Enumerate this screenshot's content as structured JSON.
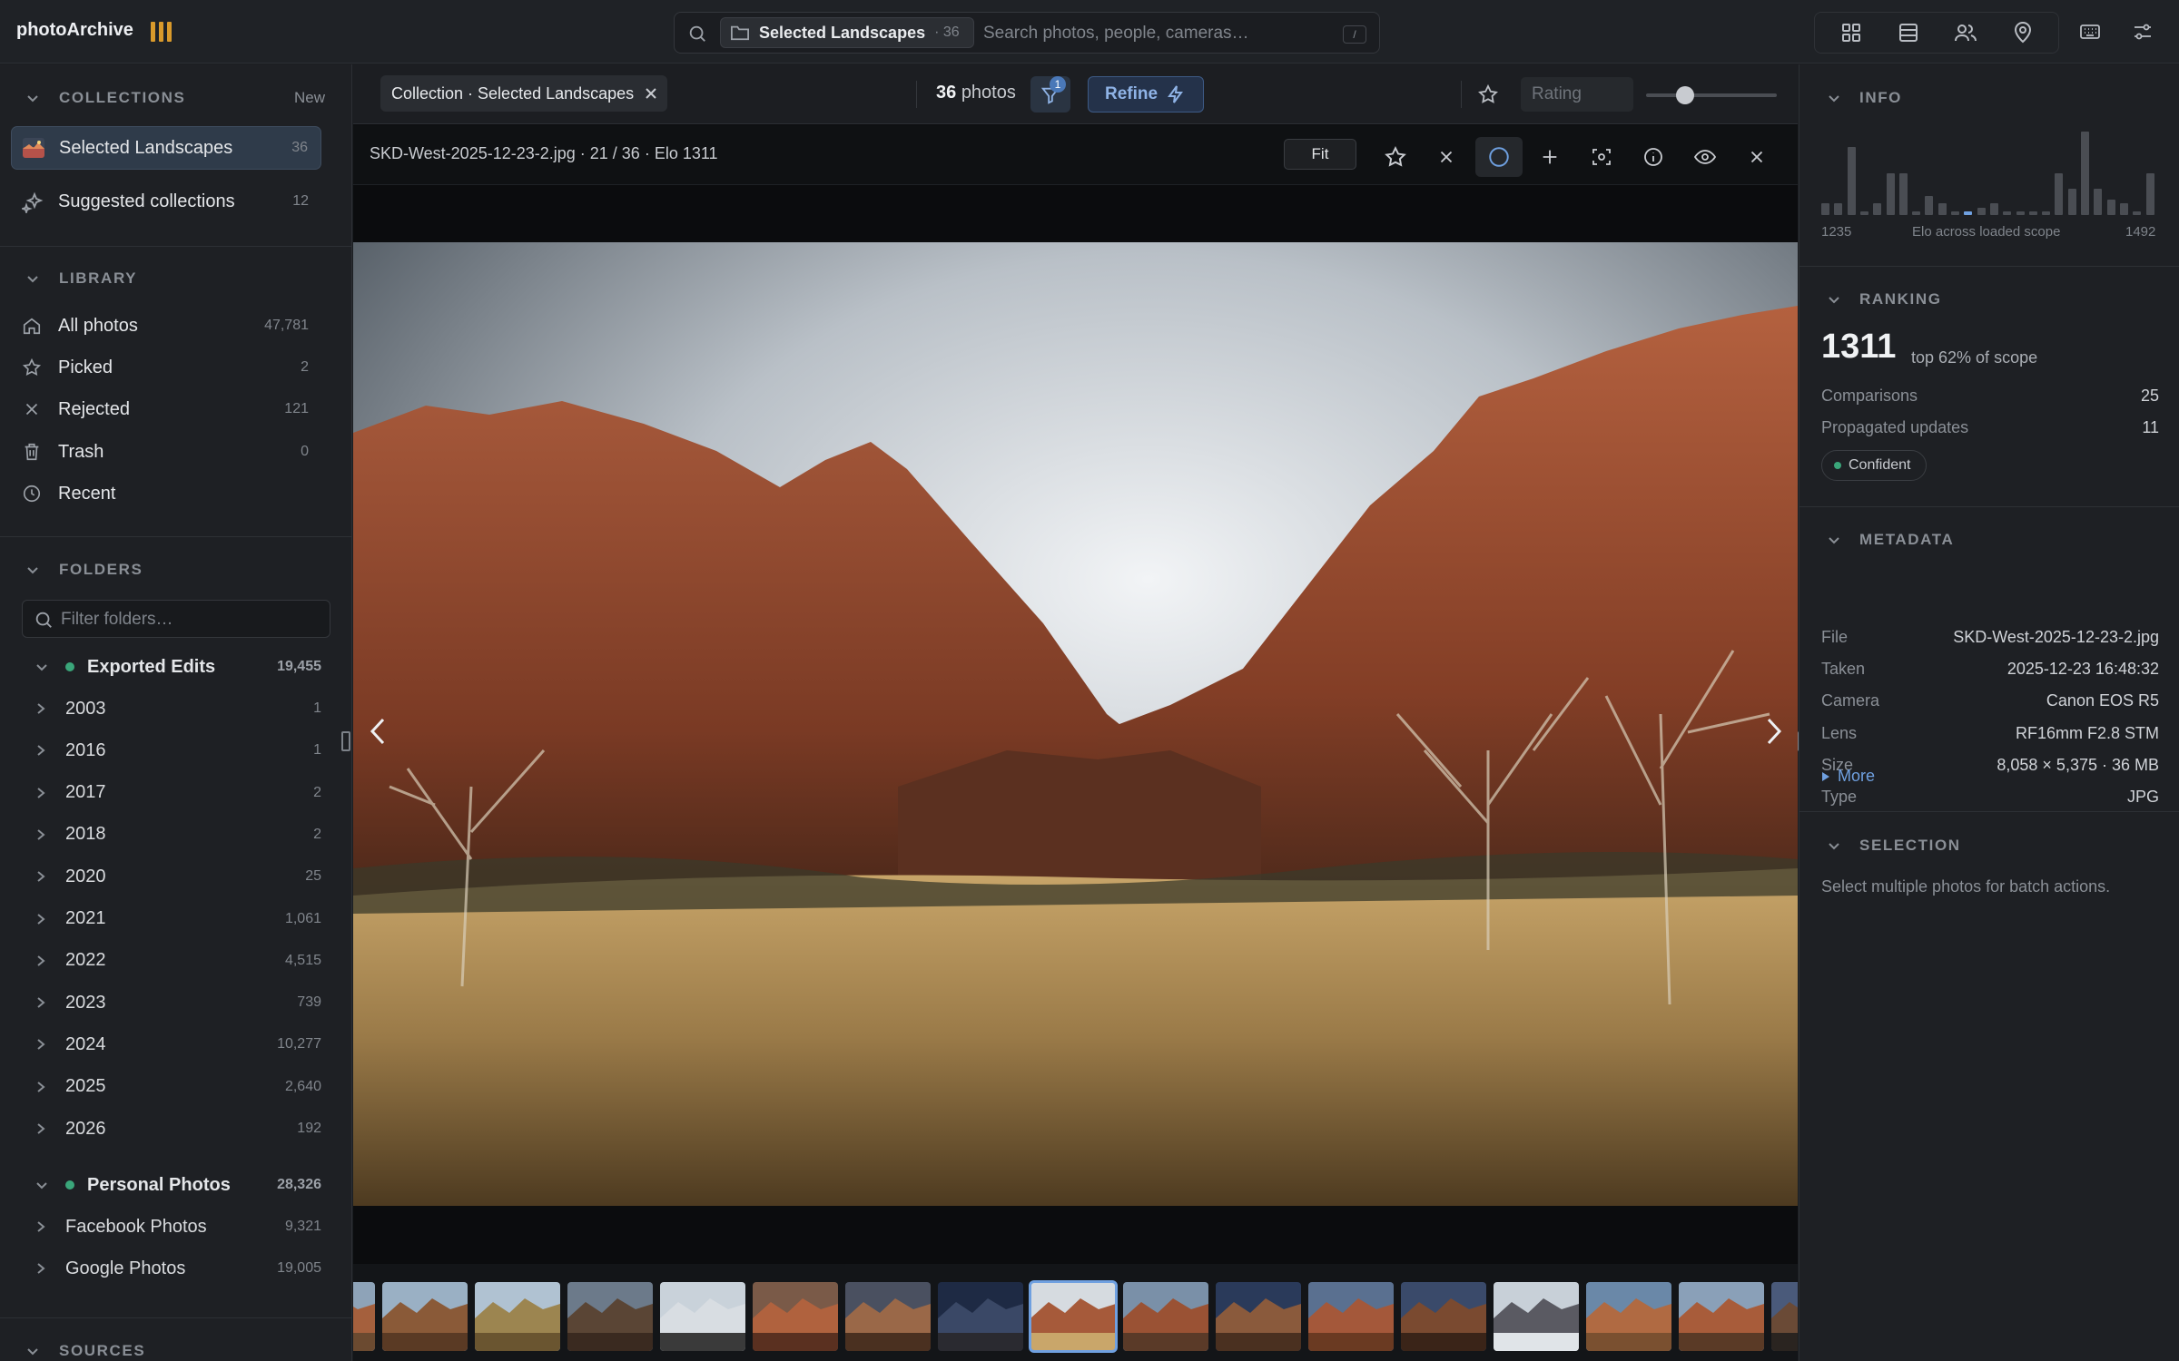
{
  "app": {
    "name": "photoArchive"
  },
  "search": {
    "scope_label": "Selected Landscapes",
    "scope_count": "· 36",
    "placeholder": "Search photos, people, cameras…",
    "shortcut": "/"
  },
  "toolbar_icons": [
    "grid-view-icon",
    "list-view-icon",
    "people-icon",
    "map-pin-icon",
    "keyboard-icon",
    "sliders-icon"
  ],
  "sidebar": {
    "collections": {
      "title": "COLLECTIONS",
      "new_label": "New",
      "items": [
        {
          "label": "Selected Landscapes",
          "count": "36"
        },
        {
          "label": "Suggested collections",
          "count": "12"
        }
      ]
    },
    "library": {
      "title": "LIBRARY",
      "items": [
        {
          "label": "All photos",
          "count": "47,781",
          "icon": "home-icon"
        },
        {
          "label": "Picked",
          "count": "2",
          "icon": "star-icon"
        },
        {
          "label": "Rejected",
          "count": "121",
          "icon": "x-icon"
        },
        {
          "label": "Trash",
          "count": "0",
          "icon": "trash-icon"
        },
        {
          "label": "Recent",
          "count": "",
          "icon": "clock-icon"
        }
      ]
    },
    "folders": {
      "title": "FOLDERS",
      "filter_placeholder": "Filter folders…",
      "groups": [
        {
          "label": "Exported Edits",
          "count": "19,455",
          "children": [
            {
              "label": "2003",
              "count": "1"
            },
            {
              "label": "2016",
              "count": "1"
            },
            {
              "label": "2017",
              "count": "2"
            },
            {
              "label": "2018",
              "count": "2"
            },
            {
              "label": "2020",
              "count": "25"
            },
            {
              "label": "2021",
              "count": "1,061"
            },
            {
              "label": "2022",
              "count": "4,515"
            },
            {
              "label": "2023",
              "count": "739"
            },
            {
              "label": "2024",
              "count": "10,277"
            },
            {
              "label": "2025",
              "count": "2,640"
            },
            {
              "label": "2026",
              "count": "192"
            }
          ]
        },
        {
          "label": "Personal Photos",
          "count": "28,326",
          "children": [
            {
              "label": "Facebook Photos",
              "count": "9,321"
            },
            {
              "label": "Google Photos",
              "count": "19,005"
            }
          ]
        }
      ]
    },
    "sources": {
      "title": "SOURCES"
    }
  },
  "center": {
    "collection_chip": "Collection · Selected Landscapes",
    "photo_count_num": "36",
    "photo_count_label": "photos",
    "filter_badge": "1",
    "refine_label": "Refine",
    "rating_placeholder": "Rating",
    "zoom_level": 0.3,
    "viewer": {
      "filename": "SKD-West-2025-12-23-2.jpg · 21 / 36 · Elo 1311",
      "fit_label": "Fit"
    },
    "filmstrip_selected_index": 7
  },
  "right": {
    "info": {
      "title": "INFO",
      "hist_min": "1235",
      "hist_caption": "Elo across loaded scope",
      "hist_max": "1492",
      "histogram": [
        3,
        3,
        18,
        1,
        3,
        11,
        11,
        1,
        5,
        3,
        1,
        1,
        2,
        3,
        1,
        1,
        1,
        1,
        11,
        7,
        22,
        7,
        4,
        3,
        1,
        11
      ]
    },
    "ranking": {
      "title": "RANKING",
      "elo": "1311",
      "subtitle": "top 62% of scope",
      "comparisons_label": "Comparisons",
      "comparisons": "25",
      "propagated_label": "Propagated updates",
      "propagated": "11",
      "confidence": "Confident"
    },
    "metadata": {
      "title": "METADATA",
      "rows": [
        {
          "k": "File",
          "v": "SKD-West-2025-12-23-2.jpg"
        },
        {
          "k": "Taken",
          "v": "2025-12-23 16:48:32"
        },
        {
          "k": "Camera",
          "v": "Canon EOS R5"
        },
        {
          "k": "Lens",
          "v": "RF16mm F2.8 STM"
        },
        {
          "k": "Size",
          "v": "8,058 × 5,375 · 36 MB"
        },
        {
          "k": "Type",
          "v": "JPG"
        }
      ],
      "more_label": "More"
    },
    "selection": {
      "title": "SELECTION",
      "text": "Select multiple photos for batch actions."
    }
  },
  "colors": {
    "accent": "#6fa0e0",
    "status_green": "#3aa67a",
    "logo_orange": "#d99a2b"
  }
}
